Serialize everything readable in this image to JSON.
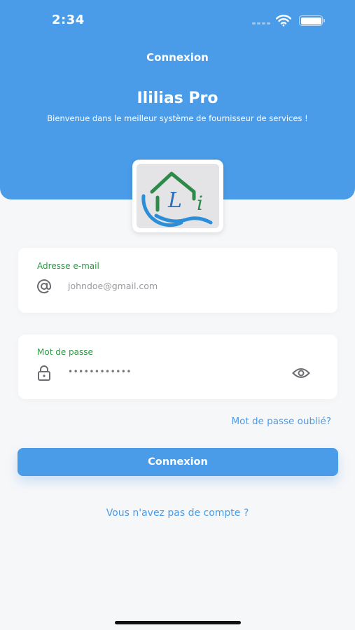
{
  "status_bar": {
    "time": "2:34"
  },
  "header": {
    "nav_title": "Connexion",
    "app_name": "Ililias Pro",
    "welcome": "Bienvenue dans le meilleur système de fournisseur de services !"
  },
  "email_field": {
    "label": "Adresse e-mail",
    "value": "johndoe@gmail.com",
    "icon": "at-icon"
  },
  "password_field": {
    "label": "Mot de passe",
    "value": "••••••••••••",
    "icon": "lock-icon",
    "toggle_icon": "eye-icon"
  },
  "forgot_password": "Mot de passe oublié?",
  "login_button": "Connexion",
  "signup_link": "Vous n'avez pas de compte ?",
  "colors": {
    "primary": "#4a9ce8",
    "label_green": "#2e9b45",
    "background": "#f6f7f9"
  }
}
